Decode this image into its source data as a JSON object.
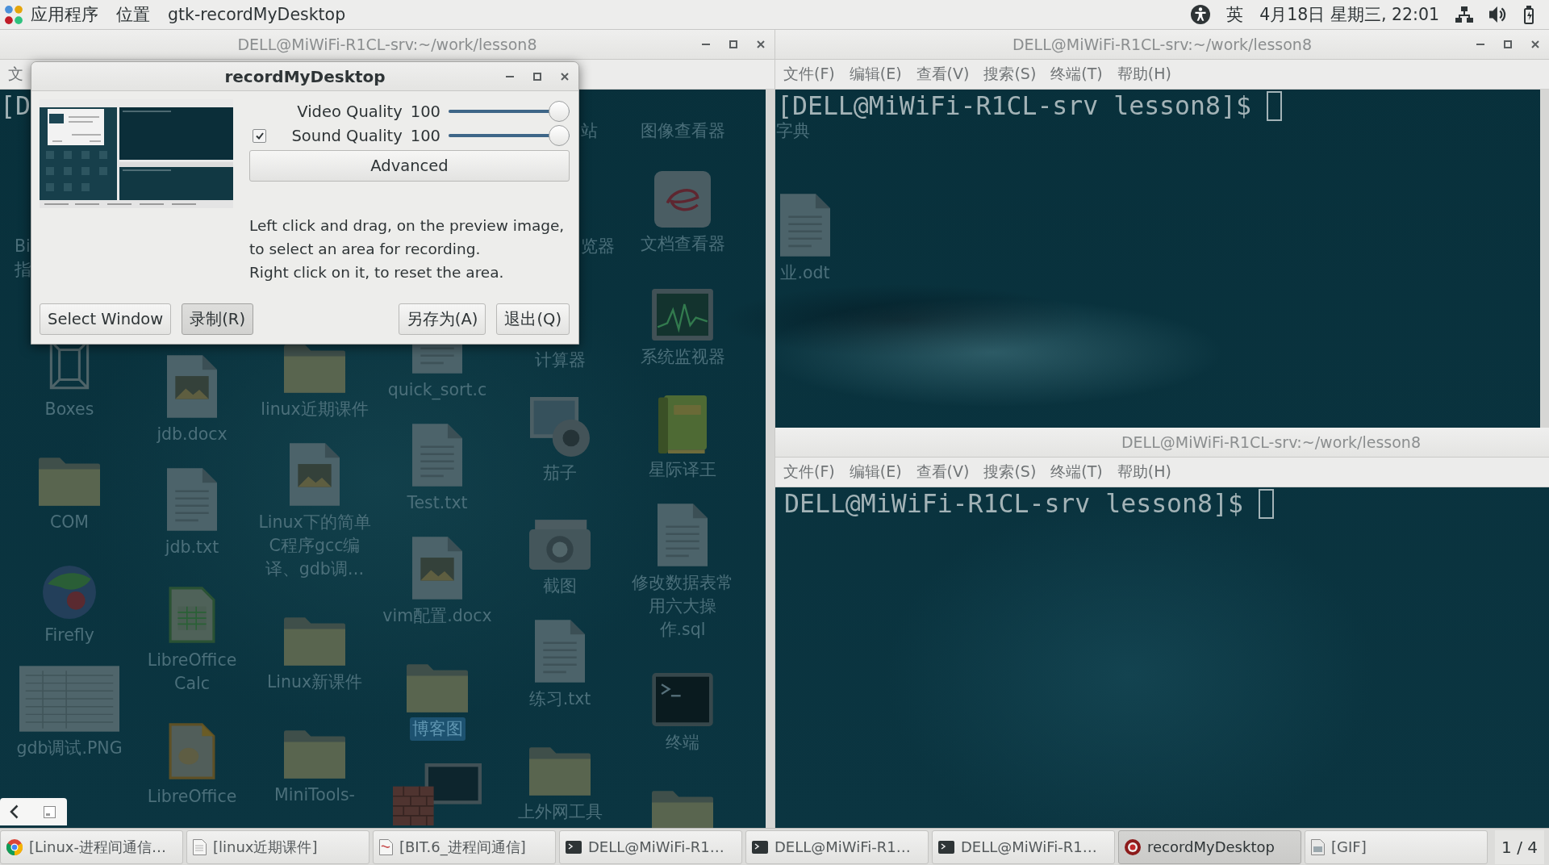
{
  "top_bar": {
    "applications": "应用程序",
    "places": "位置",
    "app_menu": "gtk-recordMyDesktop",
    "input_method": "英",
    "clock": "4月18日 星期三, 22:01"
  },
  "desktop": {
    "columns": [
      {
        "items": [
          {
            "kind": "cut",
            "label": "Bi",
            "selected": false
          },
          {
            "kind": "cut",
            "label": "指",
            "selected": false
          },
          {
            "kind": "cube",
            "label": "Boxes",
            "selected": false
          },
          {
            "kind": "folder",
            "label": "COM",
            "selected": false
          },
          {
            "kind": "ball",
            "label": "Firefly",
            "selected": false
          },
          {
            "kind": "thumbnail",
            "label": "gdb调试.PNG",
            "selected": false
          }
        ]
      },
      {
        "items": [
          {
            "kind": "imagedoc",
            "label": "jdb.docx",
            "selected": false
          },
          {
            "kind": "document",
            "label": "jdb.txt",
            "selected": false
          },
          {
            "kind": "spreadsheet",
            "label": "LibreOffice Calc",
            "selected": false
          },
          {
            "kind": "presentation",
            "label": "LibreOffice",
            "selected": false
          }
        ]
      },
      {
        "items": [
          {
            "kind": "folder",
            "label": "linux近期课件",
            "selected": false
          },
          {
            "kind": "imagedoc",
            "label": "Linux下的简单C程序gcc编译、gdb调…",
            "selected": false
          },
          {
            "kind": "folder",
            "label": "Linux新课件",
            "selected": false
          },
          {
            "kind": "folder",
            "label": "MiniTools-",
            "selected": false
          }
        ]
      },
      {
        "items": [
          {
            "kind": "document",
            "label": "quick_sort.c",
            "selected": false
          },
          {
            "kind": "document",
            "label": "Test.txt",
            "selected": false
          },
          {
            "kind": "imagedoc",
            "label": "vim配置.docx",
            "selected": false
          },
          {
            "kind": "folder",
            "label": "博客图",
            "selected": true
          },
          {
            "kind": "bricks",
            "selected": false
          }
        ]
      },
      {
        "items": [
          {
            "kind": "cut",
            "label": "站",
            "selected": false
          },
          {
            "kind": "cut",
            "label": "览器",
            "selected": false
          },
          {
            "kind": "hidden",
            "label": "计算器",
            "selected": false
          },
          {
            "kind": "webcam",
            "label": "茄子",
            "selected": false
          },
          {
            "kind": "camera",
            "label": "截图",
            "selected": false
          },
          {
            "kind": "document",
            "label": "练习.txt",
            "selected": false
          },
          {
            "kind": "folder",
            "label": "上外网工具",
            "selected": false
          }
        ]
      },
      {
        "items": [
          {
            "kind": "hidden",
            "label": "图像查看器",
            "selected": false
          },
          {
            "kind": "viewer",
            "label": "文档查看器",
            "selected": false
          },
          {
            "kind": "monitor",
            "label": "系统监视器",
            "selected": false
          },
          {
            "kind": "book",
            "label": "星际译王",
            "selected": false
          },
          {
            "kind": "document",
            "label": "修改数据表常用六大操作.sql",
            "selected": false
          },
          {
            "kind": "terminal",
            "label": "终端",
            "selected": false
          },
          {
            "kind": "folder",
            "selected": false
          }
        ]
      },
      {
        "items": [
          {
            "kind": "cut",
            "label": "字典",
            "selected": false
          },
          {
            "kind": "document",
            "label": "业.odt",
            "selected": false
          }
        ]
      }
    ]
  },
  "windows": [
    {
      "title": "DELL@MiWiFi-R1CL-srv:~/work/lesson8",
      "buttons": [
        {
          "kind": "minimize"
        },
        {
          "kind": "maximize"
        },
        {
          "kind": "close"
        }
      ],
      "menu": [
        "文"
      ],
      "lines": [
        "[D"
      ]
    },
    {
      "title": "DELL@MiWiFi-R1CL-srv:~/work/lesson8",
      "buttons": [
        {
          "kind": "minimize"
        },
        {
          "kind": "maximize"
        },
        {
          "kind": "close"
        }
      ],
      "menu": [
        "文件(F)",
        "编辑(E)",
        "查看(V)",
        "搜索(S)",
        "终端(T)",
        "帮助(H)"
      ],
      "lines": [
        "[DELL@MiWiFi-R1CL-srv lesson8]$"
      ],
      "cursor": true
    },
    {
      "title": "DELL@MiWiFi-R1CL-srv:~/work/lesson8",
      "menu": [
        "文件(F)",
        "编辑(E)",
        "查看(V)",
        "搜索(S)",
        "终端(T)",
        "帮助(H)"
      ],
      "lines": [
        "DELL@MiWiFi-R1CL-srv lesson8]$"
      ],
      "cursor": true
    }
  ],
  "dialog": {
    "title": "recordMyDesktop",
    "buttons": [
      {
        "kind": "minimize"
      },
      {
        "kind": "maximize"
      },
      {
        "kind": "close"
      }
    ],
    "settings": [
      {
        "kind": "plain",
        "label": "Video Quality",
        "value": "100",
        "level": 1
      },
      {
        "kind": "checkable",
        "label": "Sound Quality",
        "value": "100",
        "level": 1,
        "checked": true
      }
    ],
    "advanced": "Advanced",
    "hint": "Left click and drag, on the preview image,\nto select an area for recording.\nRight click on it, to reset the area.",
    "left_buttons": [
      {
        "label": "Select Window",
        "hovered": false
      },
      {
        "label": "录制(R)",
        "hovered": true
      }
    ],
    "right_buttons": [
      {
        "label": "另存为(A)",
        "hovered": false
      },
      {
        "label": "退出(Q)",
        "hovered": false
      }
    ]
  },
  "taskbar": {
    "items": [
      {
        "kind": "browser",
        "label": "[Linux-进程间通信…",
        "selected": false
      },
      {
        "kind": "document",
        "label": "[linux近期课件]",
        "selected": false
      },
      {
        "kind": "pdf",
        "label": "[BIT.6_进程间通信]",
        "selected": false
      },
      {
        "kind": "terminal",
        "label": "DELL@MiWiFi-R1…",
        "selected": false
      },
      {
        "kind": "terminal",
        "label": "DELL@MiWiFi-R1…",
        "selected": false
      },
      {
        "kind": "terminal",
        "label": "DELL@MiWiFi-R1…",
        "selected": false
      },
      {
        "kind": "recorder",
        "label": "recordMyDesktop",
        "selected": true
      },
      {
        "kind": "image",
        "label": "[GIF]",
        "selected": false
      }
    ],
    "workspace": "1 / 4"
  }
}
